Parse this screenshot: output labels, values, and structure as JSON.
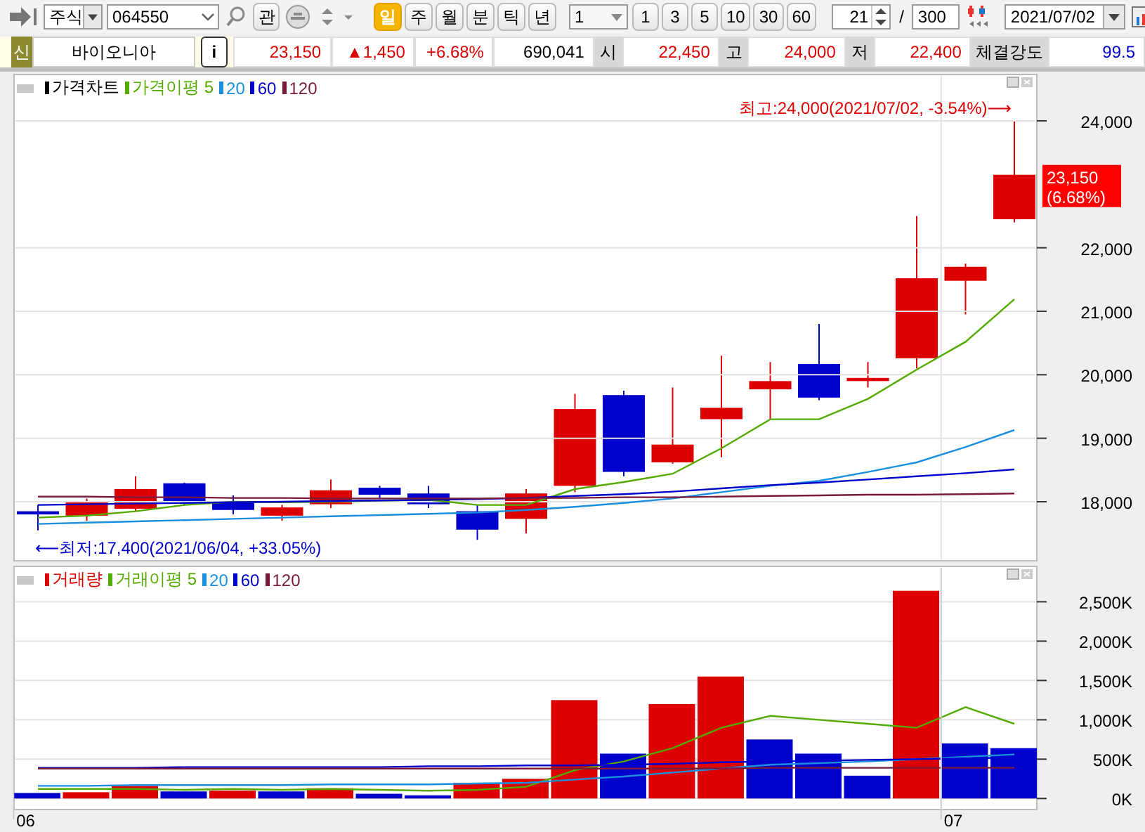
{
  "toolbar": {
    "market": "주식",
    "code": "064550",
    "jump_button": "관",
    "periods": [
      {
        "label": "일",
        "selected": true
      },
      {
        "label": "주",
        "selected": false
      },
      {
        "label": "월",
        "selected": false
      },
      {
        "label": "분",
        "selected": false
      },
      {
        "label": "틱",
        "selected": false
      },
      {
        "label": "년",
        "selected": false
      }
    ],
    "unit": "1",
    "intervals": [
      "1",
      "3",
      "5",
      "10",
      "30",
      "60"
    ],
    "count": "21",
    "separator": "/",
    "total": "300",
    "date": "2021/07/02"
  },
  "quote": {
    "badge": "신",
    "name": "바이오니아",
    "info_button": "i",
    "price": "23,150",
    "change": "▲1,450",
    "rate": "+6.68%",
    "volume": "690,041",
    "fields": [
      {
        "label": "시",
        "value": "22,450",
        "color": "#dd0000"
      },
      {
        "label": "고",
        "value": "24,000",
        "color": "#dd0000"
      },
      {
        "label": "저",
        "value": "22,400",
        "color": "#dd0000"
      },
      {
        "label": "체결강도",
        "value": "99.5",
        "color": "#0000cc"
      }
    ]
  },
  "price_chart": {
    "current_price": {
      "price": "23,150",
      "rate": "(6.68%)"
    },
    "chart_data": {
      "type": "line",
      "title": "가격차트",
      "grid": true,
      "categories": [
        null,
        null,
        null,
        null,
        null,
        null,
        null,
        null,
        null,
        null,
        null,
        null,
        null,
        null,
        null,
        null,
        null,
        null,
        null,
        null,
        null
      ],
      "ylim": [
        17070,
        24730
      ],
      "yticks": [
        {
          "value": 18000,
          "label": "18,000"
        },
        {
          "value": 19000,
          "label": "19,000"
        },
        {
          "value": 20000,
          "label": "20,000"
        },
        {
          "value": 21000,
          "label": "21,000"
        },
        {
          "value": 22000,
          "label": "22,000"
        },
        {
          "value": 24000,
          "label": "24,000"
        }
      ],
      "series": [
        {
          "name": "가격이평 5",
          "color": "#55aa00",
          "values": [
            17750,
            17780,
            17850,
            17950,
            18000,
            17990,
            18000,
            18020,
            18030,
            17950,
            17950,
            18200,
            18310,
            18440,
            18840,
            19300,
            19300,
            19620,
            20080,
            20520,
            21190
          ]
        },
        {
          "name": "20",
          "color": "#1a8fe0",
          "values": [
            17650,
            17670,
            17690,
            17710,
            17730,
            17750,
            17770,
            17790,
            17810,
            17830,
            17870,
            17920,
            17980,
            18050,
            18150,
            18250,
            18330,
            18470,
            18620,
            18860,
            19130
          ]
        },
        {
          "name": "60",
          "color": "#0000cc",
          "values": [
            17950,
            17960,
            17970,
            17980,
            17990,
            18000,
            18010,
            18020,
            18030,
            18040,
            18060,
            18090,
            18120,
            18160,
            18210,
            18260,
            18300,
            18350,
            18400,
            18450,
            18510
          ]
        },
        {
          "name": "120",
          "color": "#7a1a3a",
          "values": [
            18080,
            18080,
            18070,
            18070,
            18060,
            18060,
            18050,
            18050,
            18050,
            18050,
            18060,
            18060,
            18070,
            18070,
            18080,
            18090,
            18100,
            18110,
            18110,
            18120,
            18130
          ]
        }
      ],
      "annotations": [
        "최고:24,000(2021/07/02, -3.54%)⟶",
        "⟵최저:17,400(2021/06/04, +33.05%)"
      ]
    }
  },
  "volume_chart": {
    "chart_data": {
      "type": "bar",
      "grid": true,
      "categories": [
        "06",
        null,
        null,
        null,
        null,
        null,
        null,
        null,
        null,
        null,
        null,
        null,
        null,
        null,
        null,
        null,
        null,
        null,
        null,
        "07",
        null
      ],
      "ylim": [
        -140,
        2950
      ],
      "yticks": [
        {
          "value": 0,
          "label": "0K"
        },
        {
          "value": 500,
          "label": "500K"
        },
        {
          "value": 1000,
          "label": "1,000K"
        },
        {
          "value": 1500,
          "label": "1,500K"
        },
        {
          "value": 2000,
          "label": "2,000K"
        },
        {
          "value": 2500,
          "label": "2,500K"
        }
      ],
      "series": [
        {
          "name": "거래량",
          "color": "#dd0000",
          "colors": [
            "#0000cc",
            "#dd0000",
            "#dd0000",
            "#0000cc",
            "#dd0000",
            "#0000cc",
            "#dd0000",
            "#0000cc",
            "#0000cc",
            "#dd0000",
            "#dd0000",
            "#dd0000",
            "#0000cc",
            "#dd0000",
            "#dd0000",
            "#0000cc",
            "#0000cc",
            "#0000cc",
            "#dd0000",
            "#0000cc",
            "#0000cc"
          ],
          "values": [
            70,
            80,
            160,
            90,
            100,
            90,
            130,
            60,
            40,
            200,
            250,
            1250,
            570,
            1200,
            1550,
            750,
            570,
            290,
            2640,
            700,
            640
          ]
        },
        {
          "name": "거래이평 5",
          "type": "line",
          "color": "#55aa00",
          "values": [
            120,
            120,
            120,
            110,
            120,
            110,
            120,
            110,
            100,
            110,
            150,
            360,
            470,
            640,
            900,
            1050,
            1000,
            950,
            900,
            1160,
            950
          ]
        },
        {
          "name": "20",
          "type": "line",
          "color": "#1a8fe0",
          "values": [
            160,
            160,
            170,
            170,
            170,
            170,
            180,
            180,
            180,
            190,
            200,
            240,
            280,
            330,
            380,
            430,
            450,
            470,
            500,
            530,
            560
          ]
        },
        {
          "name": "60",
          "type": "line",
          "color": "#0000cc",
          "values": [
            390,
            390,
            390,
            400,
            400,
            400,
            400,
            400,
            410,
            410,
            420,
            420,
            430,
            440,
            460,
            470,
            480,
            490,
            500,
            510,
            520
          ]
        },
        {
          "name": "120",
          "type": "line",
          "color": "#7a1a3a",
          "values": [
            380,
            380,
            380,
            380,
            380,
            380,
            380,
            380,
            380,
            380,
            380,
            380,
            380,
            380,
            380,
            390,
            390,
            390,
            390,
            390,
            390
          ]
        }
      ]
    }
  }
}
